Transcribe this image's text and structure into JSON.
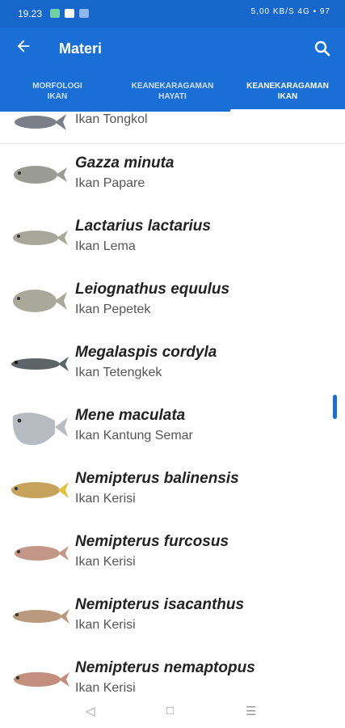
{
  "status_bar": {
    "time": "19.23",
    "right_text": "5,00 KB/S 4G ▪ 97"
  },
  "app_bar": {
    "title": "Materi",
    "back_icon": "arrow-left-icon",
    "search_icon": "search-icon"
  },
  "tabs": [
    {
      "line1": "MORFOLOGI",
      "line2": "IKAN",
      "selected": false
    },
    {
      "line1": "KEANEKARAGAMAN",
      "line2": "HAYATI",
      "selected": false
    },
    {
      "line1": "KEANEKARAGAMAN",
      "line2": "IKAN",
      "selected": true
    }
  ],
  "fish_list": [
    {
      "scientific": "",
      "local": "Ikan Tongkol",
      "color": "#7a7f88"
    },
    {
      "scientific": "Gazza minuta",
      "local": "Ikan Papare",
      "color": "#9a9c94"
    },
    {
      "scientific": "Lactarius lactarius",
      "local": "Ikan Lema",
      "color": "#a8a89a"
    },
    {
      "scientific": "Leiognathus equulus",
      "local": "Ikan Pepetek",
      "color": "#aaa89a"
    },
    {
      "scientific": "Megalaspis cordyla",
      "local": "Ikan Tetengkek",
      "color": "#5d6468"
    },
    {
      "scientific": "Mene maculata",
      "local": "Ikan Kantung Semar",
      "color": "#b7bcc2"
    },
    {
      "scientific": "Nemipterus balinensis",
      "local": "Ikan Kerisi",
      "color": "#c7a25c"
    },
    {
      "scientific": "Nemipterus furcosus",
      "local": "Ikan Kerisi",
      "color": "#c49888"
    },
    {
      "scientific": "Nemipterus isacanthus",
      "local": "Ikan Kerisi",
      "color": "#b99a7e"
    },
    {
      "scientific": "Nemipterus nemaptopus",
      "local": "Ikan Kerisi",
      "color": "#c48e7e"
    }
  ],
  "nav_bar": {
    "back": "◁",
    "home": "□",
    "menu": "☰"
  }
}
